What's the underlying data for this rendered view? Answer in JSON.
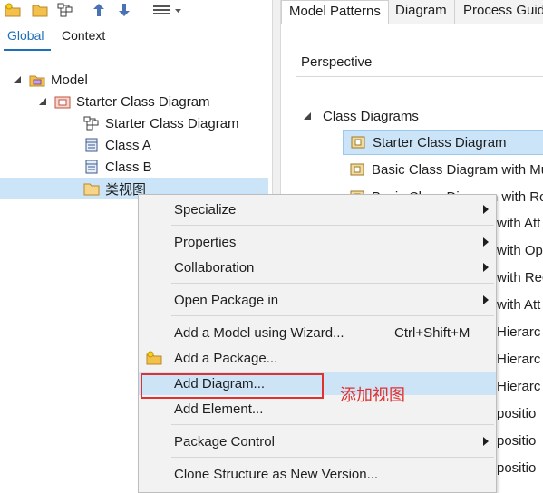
{
  "left": {
    "tabs": [
      "Global",
      "Context"
    ],
    "tree": [
      {
        "label": "Model",
        "icon": "model-package-icon"
      },
      {
        "label": "Starter Class Diagram",
        "icon": "package-icon"
      },
      {
        "label": "Starter Class Diagram",
        "icon": "class-diagram-icon"
      },
      {
        "label": "Class A",
        "icon": "class-icon"
      },
      {
        "label": "Class B",
        "icon": "class-icon"
      },
      {
        "label": "类视图",
        "icon": "folder-icon"
      }
    ],
    "toolbar_icons": [
      "new-model-icon",
      "new-folder-icon",
      "diagram-icon",
      "move-up-icon",
      "move-down-icon",
      "menu-icon"
    ]
  },
  "right": {
    "tabs": [
      "Model Patterns",
      "Diagram",
      "Process Guid"
    ],
    "perspective_label": "Perspective",
    "group_label": "Class Diagrams",
    "patterns": [
      "Starter Class Diagram",
      "Basic Class Diagram with Mu",
      "Basic Class Diagram with Rol"
    ],
    "clipped_text": [
      "with Att",
      "with Op",
      "with Rec",
      "with Att",
      "Hierarc",
      "Hierarc",
      "Hierarc",
      "positio",
      "positio",
      "positio"
    ]
  },
  "context_menu": {
    "items": [
      {
        "label": "Specialize",
        "submenu": true
      },
      {
        "label": "Properties",
        "submenu": true
      },
      {
        "label": "Collaboration",
        "submenu": true
      },
      {
        "label": "Open Package in",
        "submenu": true
      },
      {
        "label": "Add a Model using Wizard...",
        "shortcut": "Ctrl+Shift+M"
      },
      {
        "label": "Add a Package..."
      },
      {
        "label": "Add Diagram..."
      },
      {
        "label": "Add Element..."
      },
      {
        "label": "Package Control",
        "submenu": true
      },
      {
        "label": "Clone Structure as New Version..."
      }
    ]
  },
  "annotation": "添加视图",
  "colors": {
    "selection": "#cce4f7",
    "annotation": "#e03030",
    "link_blue": "#1f6fb8"
  }
}
